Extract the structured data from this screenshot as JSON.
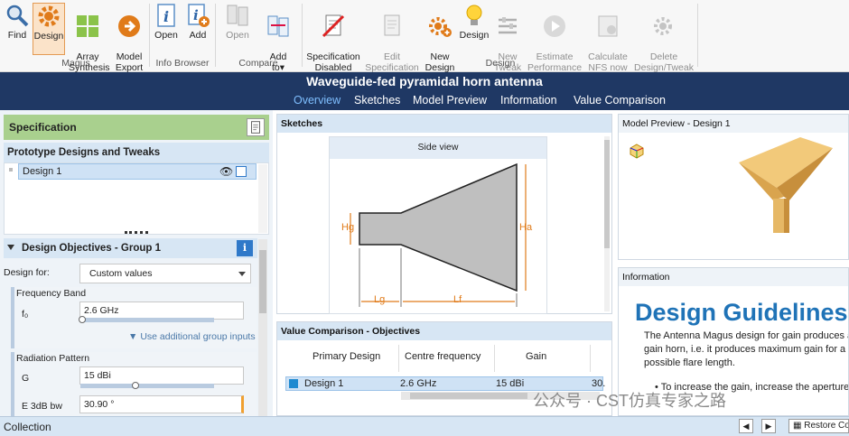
{
  "ribbon": {
    "buttons": [
      {
        "label": "Find",
        "icon": "find-icon"
      },
      {
        "label": "Design",
        "icon": "design-gear-icon"
      },
      {
        "label": "Array\nSynthesis",
        "icon": "array-synthesis-icon"
      },
      {
        "label": "Model\nExport",
        "icon": "model-export-icon"
      },
      {
        "label": "Open",
        "icon": "info-open-icon"
      },
      {
        "label": "Add",
        "icon": "info-add-icon"
      },
      {
        "label": "Open",
        "icon": "compare-open-icon"
      },
      {
        "label": "Add\nto",
        "icon": "compare-add-icon"
      },
      {
        "label": "Specification\nDisabled",
        "icon": "specification-disabled-icon"
      },
      {
        "label": "Edit\nSpecification",
        "icon": "edit-specification-icon"
      },
      {
        "label": "New\nDesign",
        "icon": "new-design-icon"
      },
      {
        "label": "Design",
        "icon": "design-bulb-icon"
      },
      {
        "label": "New\nTweak",
        "icon": "new-tweak-icon"
      },
      {
        "label": "Estimate\nPerformance",
        "icon": "estimate-performance-icon"
      },
      {
        "label": "Calculate\nNFS now",
        "icon": "calculate-nfs-icon"
      },
      {
        "label": "Delete\nDesign/Tweak",
        "icon": "delete-design-icon"
      }
    ],
    "groups": {
      "magus": "Magus",
      "info": "Info Browser",
      "compare": "Compare",
      "design": "Design"
    },
    "add_to_arrow": "▾"
  },
  "title": "Waveguide-fed pyramidal horn antenna",
  "tabs": [
    "Overview",
    "Sketches",
    "Model Preview",
    "Information",
    "Value Comparison"
  ],
  "specification": {
    "header": "Specification",
    "prototype_header": "Prototype Designs and Tweaks",
    "designs": [
      "Design 1"
    ],
    "objectives_header": "Design Objectives  -  Group 1",
    "design_for_label": "Design for:",
    "design_for_value": "Custom values",
    "frequency_band": "Frequency Band",
    "f0_label": "f₀",
    "f0_value": "2.6 GHz",
    "additional_inputs": "Use additional group inputs",
    "radiation_pattern": "Radiation Pattern",
    "gain_label": "G",
    "gain_value": "15 dBi",
    "bw_label": "E 3dB  bw",
    "bw_value": "30.90 °"
  },
  "sketches": {
    "header": "Sketches",
    "view_title": "Side view",
    "labels": {
      "hg": "Hg",
      "ha": "Ha",
      "lg": "Lg",
      "lf": "Lf"
    }
  },
  "model_preview": {
    "header": "Model Preview  -  Design 1"
  },
  "information": {
    "header": "Information",
    "heading": "Design Guidelines",
    "para1": "The Antenna Magus design for gain produces a gain horn, i.e. it produces maximum gain for a possible flare length.",
    "bullet": "To increase the gain, increase the aperture"
  },
  "value_comparison": {
    "header": "Value Comparison - Objectives",
    "columns": [
      "Primary Design",
      "Centre frequency",
      "Gain"
    ],
    "rows": [
      [
        "Design 1",
        "2.6 GHz",
        "15 dBi",
        "30."
      ]
    ]
  },
  "watermark": "公众号 · CST仿真专家之路",
  "status": {
    "collection": "Collection",
    "restore": "Restore Co"
  },
  "colors": {
    "title_bg": "#1f3864",
    "accent": "#7fbfff",
    "spec_green": "#a9d08e",
    "panel_blue": "#d7e6f4",
    "horn_gold": "#e8b96a"
  }
}
